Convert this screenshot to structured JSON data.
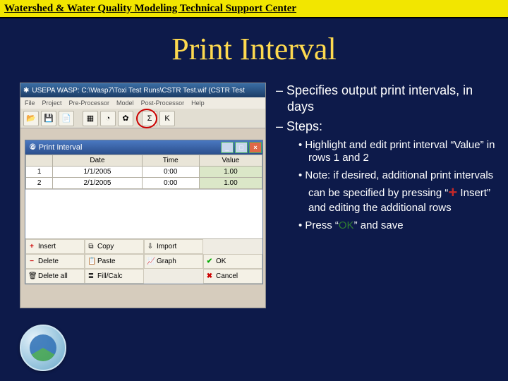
{
  "topbar": {
    "label": "Watershed & Water Quality Modeling Technical Support Center"
  },
  "slide": {
    "title": "Print Interval"
  },
  "app": {
    "title_prefix": "USEPA WASP: C:\\Wasp7\\Toxi Test Runs\\CSTR Test.wif (CSTR Test",
    "menu": [
      "File",
      "Project",
      "Pre-Processor",
      "Model",
      "Post-Processor",
      "Help"
    ],
    "toolbar_icons": [
      "folder-open-icon",
      "save-icon",
      "new-page-icon",
      "divider",
      "table-icon",
      "clock-icon",
      "gear-icon",
      "divider",
      "sigma-icon",
      "k-icon",
      "divider"
    ],
    "toolbar_glyphs": {
      "folder-open-icon": "📂",
      "save-icon": "💾",
      "new-page-icon": "📄",
      "table-icon": "▦",
      "clock-icon": "◔",
      "gear-icon": "✿",
      "sigma-icon": "Σ",
      "k-icon": "K"
    }
  },
  "dialog": {
    "title": "Print Interval",
    "columns": [
      "",
      "Date",
      "Time",
      "Value"
    ],
    "rows": [
      {
        "n": "1",
        "date": "1/1/2005",
        "time": "0:00",
        "value": "1.00"
      },
      {
        "n": "2",
        "date": "2/1/2005",
        "time": "0:00",
        "value": "1.00"
      }
    ],
    "buttons": {
      "insert": "Insert",
      "copy": "Copy",
      "import": "Import",
      "delete": "Delete",
      "paste": "Paste",
      "graph": "Graph",
      "deleteall": "Delete all",
      "fill": "Fill/Calc",
      "ok": "OK",
      "cancel": "Cancel"
    }
  },
  "notes": {
    "line1": "Specifies output print intervals, in days",
    "line2": "Steps:",
    "b1": "Highlight and edit print interval “Value” in rows 1 and 2",
    "b2": "Note: if desired, additional print intervals can be specified by pressing “",
    "b2_insert": " Insert” and editing the additional rows",
    "b3_a": "Press “",
    "b3_ok": "OK",
    "b3_b": "” and save"
  }
}
